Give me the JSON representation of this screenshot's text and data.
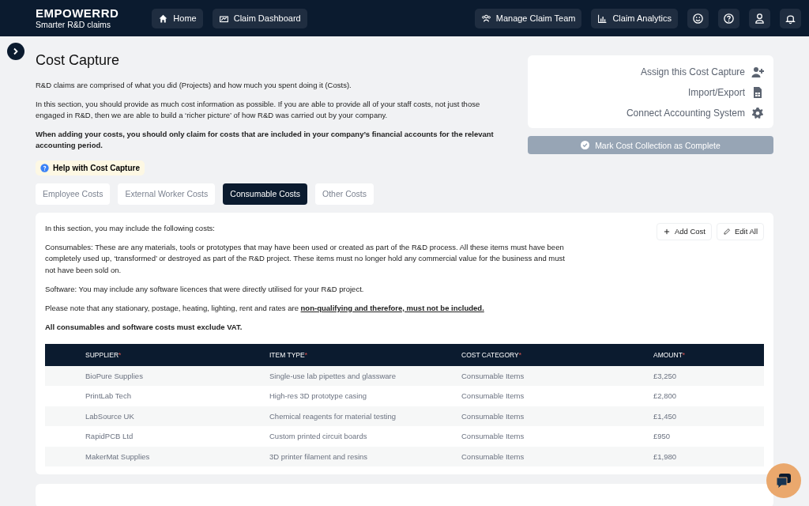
{
  "header": {
    "logo": "EMPOWERRD",
    "tagline": "Smarter R&D claims",
    "nav_left": [
      {
        "label": "Home"
      },
      {
        "label": "Claim Dashboard"
      }
    ],
    "nav_right": [
      {
        "label": "Manage Claim Team"
      },
      {
        "label": "Claim Analytics"
      }
    ]
  },
  "page": {
    "title": "Cost Capture",
    "intro": [
      "R&D claims are comprised of what you did (Projects) and how much you spent doing it (Costs).",
      "In this section, you should provide as much cost information as possible. If you are able to provide all of your staff costs, not just those engaged in R&D, then we are able to build a ‘richer picture’ of how R&D was carried out by your company."
    ],
    "notice": "When adding your costs, you should only claim for costs that are included in your company’s financial accounts for the relevant accounting period.",
    "help": "Help with Cost Capture",
    "actions": [
      {
        "label": "Assign this Cost Capture"
      },
      {
        "label": "Import/Export"
      },
      {
        "label": "Connect Accounting System"
      }
    ],
    "complete_button": {
      "label": "Mark Cost Collection as Complete",
      "disabled": true
    },
    "tabs": [
      {
        "label": "Employee Costs",
        "selected": false
      },
      {
        "label": "External Worker Costs",
        "selected": false
      },
      {
        "label": "Consumable Costs",
        "selected": true
      },
      {
        "label": "Other Costs",
        "selected": false
      }
    ]
  },
  "section": {
    "paragraphs": [
      {
        "kind": "plain",
        "text": "In this section, you may include the following costs:"
      },
      {
        "kind": "plain",
        "text": "Consumables: These are any materials, tools or prototypes that may have been used or created as part of the R&D process. All these items must have been completely used up, ‘transformed’ or destroyed as part of the R&D project. These items must no longer hold any commercial value for the business and must not have been sold on."
      },
      {
        "kind": "plain",
        "text": "Software: You may include any software licences that were directly utilised for your R&D project."
      },
      {
        "kind": "link",
        "text": "Please note that any stationary, postage, heating, lighting, rent and rates are ",
        "link": "non-qualifying and therefore, must not be included."
      },
      {
        "kind": "bold",
        "text": "All consumables and software costs must exclude VAT."
      }
    ],
    "buttons": [
      {
        "label": "Add Cost"
      },
      {
        "label": "Edit All"
      }
    ],
    "table": {
      "columns": [
        {
          "label": "SUPPLIER",
          "marker": "*"
        },
        {
          "label": "ITEM TYPE",
          "marker": "*"
        },
        {
          "label": "COST CATEGORY",
          "marker": "*"
        },
        {
          "label": "AMOUNT",
          "marker": "*"
        }
      ],
      "rows": [
        [
          "BioPure Supplies",
          "Single-use lab pipettes and glassware",
          "Consumable Items",
          "£3,250"
        ],
        [
          "PrintLab Tech",
          "High-res 3D prototype casing",
          "Consumable Items",
          "£2,800"
        ],
        [
          "LabSource UK",
          "Chemical reagents for material testing",
          "Consumable Items",
          "£1,450"
        ],
        [
          "RapidPCB Ltd",
          "Custom printed circuit boards",
          "Consumable Items",
          "£950"
        ],
        [
          "MakerMat Supplies",
          "3D printer filament and resins",
          "Consumable Items",
          "£1,980"
        ]
      ]
    }
  }
}
